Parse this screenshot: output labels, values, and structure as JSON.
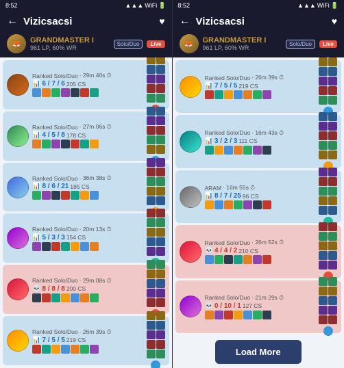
{
  "left_panel": {
    "status_bar": {
      "time": "8:52",
      "signal": "●●●●",
      "wifi": "WiFi",
      "battery": "■■"
    },
    "header": {
      "back": "←",
      "title": "Vizicsacsi",
      "heart": "♥"
    },
    "player": {
      "rank": "GRANDMASTER I",
      "lp": "961 LP, 60% WR",
      "mode": "Solo/Duo",
      "status": "Live"
    },
    "matches": [
      {
        "type": "Ranked Solo/Duo",
        "time": "29m 40s",
        "result": "win",
        "kda": "6 / 7 / 6",
        "cs": "205 CS",
        "champ_class": "c1",
        "items": [
          "i1",
          "i2",
          "i3",
          "i4",
          "i5",
          "i6",
          "i7"
        ],
        "spell1": "s1",
        "spell2": "s2",
        "rune": "r1",
        "participants": [
          "p1",
          "p2",
          "p3",
          "p4",
          "p5",
          "p1",
          "p2",
          "p3",
          "p4",
          "p5"
        ]
      },
      {
        "type": "Ranked Solo/Duo",
        "time": "27m 06s",
        "result": "win",
        "kda": "4 / 5 / 8",
        "cs": "178 CS",
        "champ_class": "c2",
        "items": [
          "i2",
          "i3",
          "i4",
          "i5",
          "i6",
          "i7",
          "i8"
        ],
        "spell1": "s2",
        "spell2": "s3",
        "rune": "r2",
        "participants": [
          "p2",
          "p3",
          "p4",
          "p5",
          "p1",
          "p2",
          "p3",
          "p4",
          "p5",
          "p1"
        ]
      },
      {
        "type": "Ranked Solo/Duo",
        "time": "36m 38s",
        "result": "win",
        "kda": "8 / 6 / 21",
        "cs": "185 CS",
        "champ_class": "c3",
        "items": [
          "i3",
          "i4",
          "i5",
          "i6",
          "i7",
          "i8",
          "i1"
        ],
        "spell1": "s3",
        "spell2": "s4",
        "rune": "r3",
        "participants": [
          "p3",
          "p4",
          "p5",
          "p1",
          "p2",
          "p3",
          "p4",
          "p5",
          "p1",
          "p2"
        ]
      },
      {
        "type": "Ranked Solo/Duo",
        "time": "20m 13s",
        "result": "win",
        "kda": "5 / 3 / 3",
        "cs": "154 CS",
        "champ_class": "c4",
        "items": [
          "i4",
          "i5",
          "i6",
          "i7",
          "i8",
          "i1",
          "i2"
        ],
        "spell1": "s1",
        "spell2": "s3",
        "rune": "r4",
        "participants": [
          "p4",
          "p5",
          "p1",
          "p2",
          "p3",
          "p4",
          "p5",
          "p1",
          "p2",
          "p3"
        ]
      },
      {
        "type": "Ranked Solo/Duo",
        "time": "29m 08s",
        "result": "loss",
        "kda": "8 / 8 / 8",
        "cs": "200 CS",
        "champ_class": "c5",
        "items": [
          "i5",
          "i6",
          "i7",
          "i8",
          "i1",
          "i2",
          "i3"
        ],
        "spell1": "s2",
        "spell2": "s4",
        "rune": "r1",
        "participants": [
          "p5",
          "p1",
          "p2",
          "p3",
          "p4",
          "p5",
          "p1",
          "p2",
          "p3",
          "p4"
        ]
      },
      {
        "type": "Ranked Solo/Duo",
        "time": "26m 39s",
        "result": "win",
        "kda": "7 / 5 / 5",
        "cs": "219 CS",
        "champ_class": "c6",
        "items": [
          "i6",
          "i7",
          "i8",
          "i1",
          "i2",
          "i3",
          "i4"
        ],
        "spell1": "s1",
        "spell2": "s2",
        "rune": "r2",
        "participants": [
          "p1",
          "p2",
          "p3",
          "p4",
          "p5",
          "p1",
          "p2",
          "p3",
          "p4",
          "p5"
        ]
      }
    ]
  },
  "right_panel": {
    "status_bar": {
      "time": "8:52"
    },
    "header": {
      "back": "←",
      "title": "Vizicsacsi",
      "heart": "♥"
    },
    "player": {
      "rank": "GRANDMASTER I",
      "lp": "961 LP, 60% WR",
      "mode": "Solo/Duo",
      "status": "Live"
    },
    "matches": [
      {
        "type": "Ranked Solo/Duo",
        "time": "26m 39s",
        "result": "win",
        "kda": "7 / 5 / 5",
        "cs": "219 CS",
        "champ_class": "c6",
        "items": [
          "i6",
          "i7",
          "i8",
          "i1",
          "i2",
          "i3",
          "i4"
        ],
        "spell1": "s1",
        "spell2": "s2",
        "rune": "r2",
        "participants": [
          "p1",
          "p2",
          "p3",
          "p4",
          "p5",
          "p1",
          "p2",
          "p3",
          "p4",
          "p5"
        ]
      },
      {
        "type": "Ranked Solo/Duo",
        "time": "16m 43s",
        "result": "win",
        "kda": "3 / 2 / 3",
        "cs": "111 CS",
        "champ_class": "c7",
        "items": [
          "i7",
          "i8",
          "i1",
          "i2",
          "i3",
          "i4",
          "i5"
        ],
        "spell1": "s3",
        "spell2": "s1",
        "rune": "r3",
        "participants": [
          "p2",
          "p3",
          "p4",
          "p5",
          "p1",
          "p2",
          "p3",
          "p4",
          "p5",
          "p1"
        ]
      },
      {
        "type": "ARAM",
        "time": "16m 55s",
        "result": "win",
        "kda": "8 / 7 / 25",
        "cs": "96 CS",
        "champ_class": "c8",
        "items": [
          "i8",
          "i1",
          "i2",
          "i3",
          "i4",
          "i5",
          "i6"
        ],
        "spell1": "s4",
        "spell2": "s2",
        "rune": "r4",
        "participants": [
          "p3",
          "p4",
          "p5",
          "p1",
          "p2",
          "p3",
          "p4",
          "p5",
          "p1",
          "p2"
        ]
      },
      {
        "type": "Ranked Solo/Duo",
        "time": "26m 52s",
        "result": "loss",
        "kda": "4 / 4 / 2",
        "cs": "210 CS",
        "champ_class": "c5",
        "items": [
          "i1",
          "i3",
          "i5",
          "i7",
          "i2",
          "i4",
          "i6"
        ],
        "spell1": "s1",
        "spell2": "s4",
        "rune": "r1",
        "participants": [
          "p4",
          "p5",
          "p1",
          "p2",
          "p3",
          "p4",
          "p5",
          "p1",
          "p2",
          "p3"
        ]
      },
      {
        "type": "Ranked Solo/Duo",
        "time": "21m 29s",
        "result": "loss",
        "kda": "0 / 10 / 1",
        "cs": "127 CS",
        "champ_class": "c4",
        "items": [
          "i2",
          "i4",
          "i6",
          "i8",
          "i1",
          "i3",
          "i5"
        ],
        "spell1": "s2",
        "spell2": "s3",
        "rune": "r2",
        "participants": [
          "p5",
          "p1",
          "p2",
          "p3",
          "p4",
          "p5",
          "p1",
          "p2",
          "p3",
          "p4"
        ]
      }
    ],
    "load_more": "Load More"
  }
}
